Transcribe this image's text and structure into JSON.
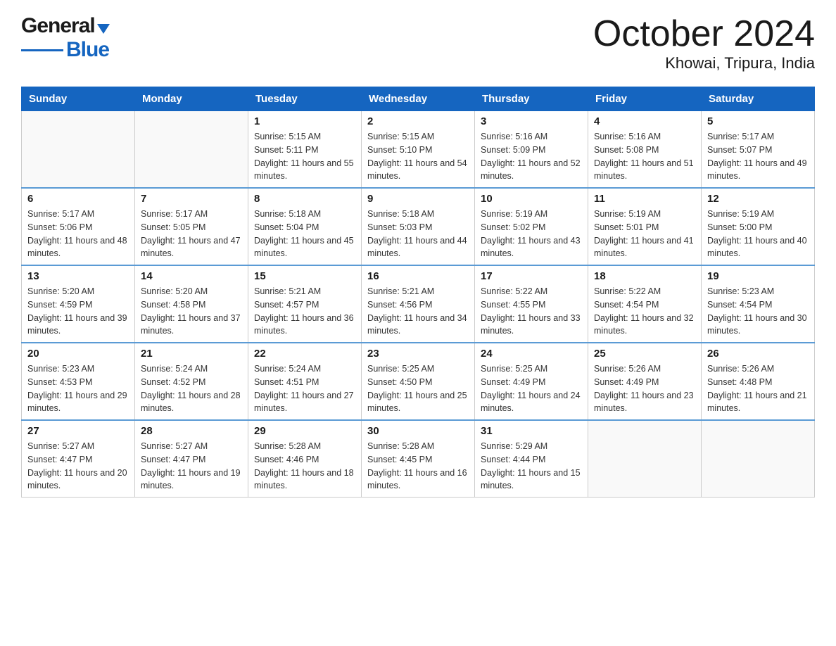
{
  "header": {
    "logo_general": "General",
    "logo_blue": "Blue",
    "title": "October 2024",
    "subtitle": "Khowai, Tripura, India"
  },
  "weekdays": [
    "Sunday",
    "Monday",
    "Tuesday",
    "Wednesday",
    "Thursday",
    "Friday",
    "Saturday"
  ],
  "weeks": [
    [
      {
        "day": "",
        "sunrise": "",
        "sunset": "",
        "daylight": ""
      },
      {
        "day": "",
        "sunrise": "",
        "sunset": "",
        "daylight": ""
      },
      {
        "day": "1",
        "sunrise": "Sunrise: 5:15 AM",
        "sunset": "Sunset: 5:11 PM",
        "daylight": "Daylight: 11 hours and 55 minutes."
      },
      {
        "day": "2",
        "sunrise": "Sunrise: 5:15 AM",
        "sunset": "Sunset: 5:10 PM",
        "daylight": "Daylight: 11 hours and 54 minutes."
      },
      {
        "day": "3",
        "sunrise": "Sunrise: 5:16 AM",
        "sunset": "Sunset: 5:09 PM",
        "daylight": "Daylight: 11 hours and 52 minutes."
      },
      {
        "day": "4",
        "sunrise": "Sunrise: 5:16 AM",
        "sunset": "Sunset: 5:08 PM",
        "daylight": "Daylight: 11 hours and 51 minutes."
      },
      {
        "day": "5",
        "sunrise": "Sunrise: 5:17 AM",
        "sunset": "Sunset: 5:07 PM",
        "daylight": "Daylight: 11 hours and 49 minutes."
      }
    ],
    [
      {
        "day": "6",
        "sunrise": "Sunrise: 5:17 AM",
        "sunset": "Sunset: 5:06 PM",
        "daylight": "Daylight: 11 hours and 48 minutes."
      },
      {
        "day": "7",
        "sunrise": "Sunrise: 5:17 AM",
        "sunset": "Sunset: 5:05 PM",
        "daylight": "Daylight: 11 hours and 47 minutes."
      },
      {
        "day": "8",
        "sunrise": "Sunrise: 5:18 AM",
        "sunset": "Sunset: 5:04 PM",
        "daylight": "Daylight: 11 hours and 45 minutes."
      },
      {
        "day": "9",
        "sunrise": "Sunrise: 5:18 AM",
        "sunset": "Sunset: 5:03 PM",
        "daylight": "Daylight: 11 hours and 44 minutes."
      },
      {
        "day": "10",
        "sunrise": "Sunrise: 5:19 AM",
        "sunset": "Sunset: 5:02 PM",
        "daylight": "Daylight: 11 hours and 43 minutes."
      },
      {
        "day": "11",
        "sunrise": "Sunrise: 5:19 AM",
        "sunset": "Sunset: 5:01 PM",
        "daylight": "Daylight: 11 hours and 41 minutes."
      },
      {
        "day": "12",
        "sunrise": "Sunrise: 5:19 AM",
        "sunset": "Sunset: 5:00 PM",
        "daylight": "Daylight: 11 hours and 40 minutes."
      }
    ],
    [
      {
        "day": "13",
        "sunrise": "Sunrise: 5:20 AM",
        "sunset": "Sunset: 4:59 PM",
        "daylight": "Daylight: 11 hours and 39 minutes."
      },
      {
        "day": "14",
        "sunrise": "Sunrise: 5:20 AM",
        "sunset": "Sunset: 4:58 PM",
        "daylight": "Daylight: 11 hours and 37 minutes."
      },
      {
        "day": "15",
        "sunrise": "Sunrise: 5:21 AM",
        "sunset": "Sunset: 4:57 PM",
        "daylight": "Daylight: 11 hours and 36 minutes."
      },
      {
        "day": "16",
        "sunrise": "Sunrise: 5:21 AM",
        "sunset": "Sunset: 4:56 PM",
        "daylight": "Daylight: 11 hours and 34 minutes."
      },
      {
        "day": "17",
        "sunrise": "Sunrise: 5:22 AM",
        "sunset": "Sunset: 4:55 PM",
        "daylight": "Daylight: 11 hours and 33 minutes."
      },
      {
        "day": "18",
        "sunrise": "Sunrise: 5:22 AM",
        "sunset": "Sunset: 4:54 PM",
        "daylight": "Daylight: 11 hours and 32 minutes."
      },
      {
        "day": "19",
        "sunrise": "Sunrise: 5:23 AM",
        "sunset": "Sunset: 4:54 PM",
        "daylight": "Daylight: 11 hours and 30 minutes."
      }
    ],
    [
      {
        "day": "20",
        "sunrise": "Sunrise: 5:23 AM",
        "sunset": "Sunset: 4:53 PM",
        "daylight": "Daylight: 11 hours and 29 minutes."
      },
      {
        "day": "21",
        "sunrise": "Sunrise: 5:24 AM",
        "sunset": "Sunset: 4:52 PM",
        "daylight": "Daylight: 11 hours and 28 minutes."
      },
      {
        "day": "22",
        "sunrise": "Sunrise: 5:24 AM",
        "sunset": "Sunset: 4:51 PM",
        "daylight": "Daylight: 11 hours and 27 minutes."
      },
      {
        "day": "23",
        "sunrise": "Sunrise: 5:25 AM",
        "sunset": "Sunset: 4:50 PM",
        "daylight": "Daylight: 11 hours and 25 minutes."
      },
      {
        "day": "24",
        "sunrise": "Sunrise: 5:25 AM",
        "sunset": "Sunset: 4:49 PM",
        "daylight": "Daylight: 11 hours and 24 minutes."
      },
      {
        "day": "25",
        "sunrise": "Sunrise: 5:26 AM",
        "sunset": "Sunset: 4:49 PM",
        "daylight": "Daylight: 11 hours and 23 minutes."
      },
      {
        "day": "26",
        "sunrise": "Sunrise: 5:26 AM",
        "sunset": "Sunset: 4:48 PM",
        "daylight": "Daylight: 11 hours and 21 minutes."
      }
    ],
    [
      {
        "day": "27",
        "sunrise": "Sunrise: 5:27 AM",
        "sunset": "Sunset: 4:47 PM",
        "daylight": "Daylight: 11 hours and 20 minutes."
      },
      {
        "day": "28",
        "sunrise": "Sunrise: 5:27 AM",
        "sunset": "Sunset: 4:47 PM",
        "daylight": "Daylight: 11 hours and 19 minutes."
      },
      {
        "day": "29",
        "sunrise": "Sunrise: 5:28 AM",
        "sunset": "Sunset: 4:46 PM",
        "daylight": "Daylight: 11 hours and 18 minutes."
      },
      {
        "day": "30",
        "sunrise": "Sunrise: 5:28 AM",
        "sunset": "Sunset: 4:45 PM",
        "daylight": "Daylight: 11 hours and 16 minutes."
      },
      {
        "day": "31",
        "sunrise": "Sunrise: 5:29 AM",
        "sunset": "Sunset: 4:44 PM",
        "daylight": "Daylight: 11 hours and 15 minutes."
      },
      {
        "day": "",
        "sunrise": "",
        "sunset": "",
        "daylight": ""
      },
      {
        "day": "",
        "sunrise": "",
        "sunset": "",
        "daylight": ""
      }
    ]
  ]
}
